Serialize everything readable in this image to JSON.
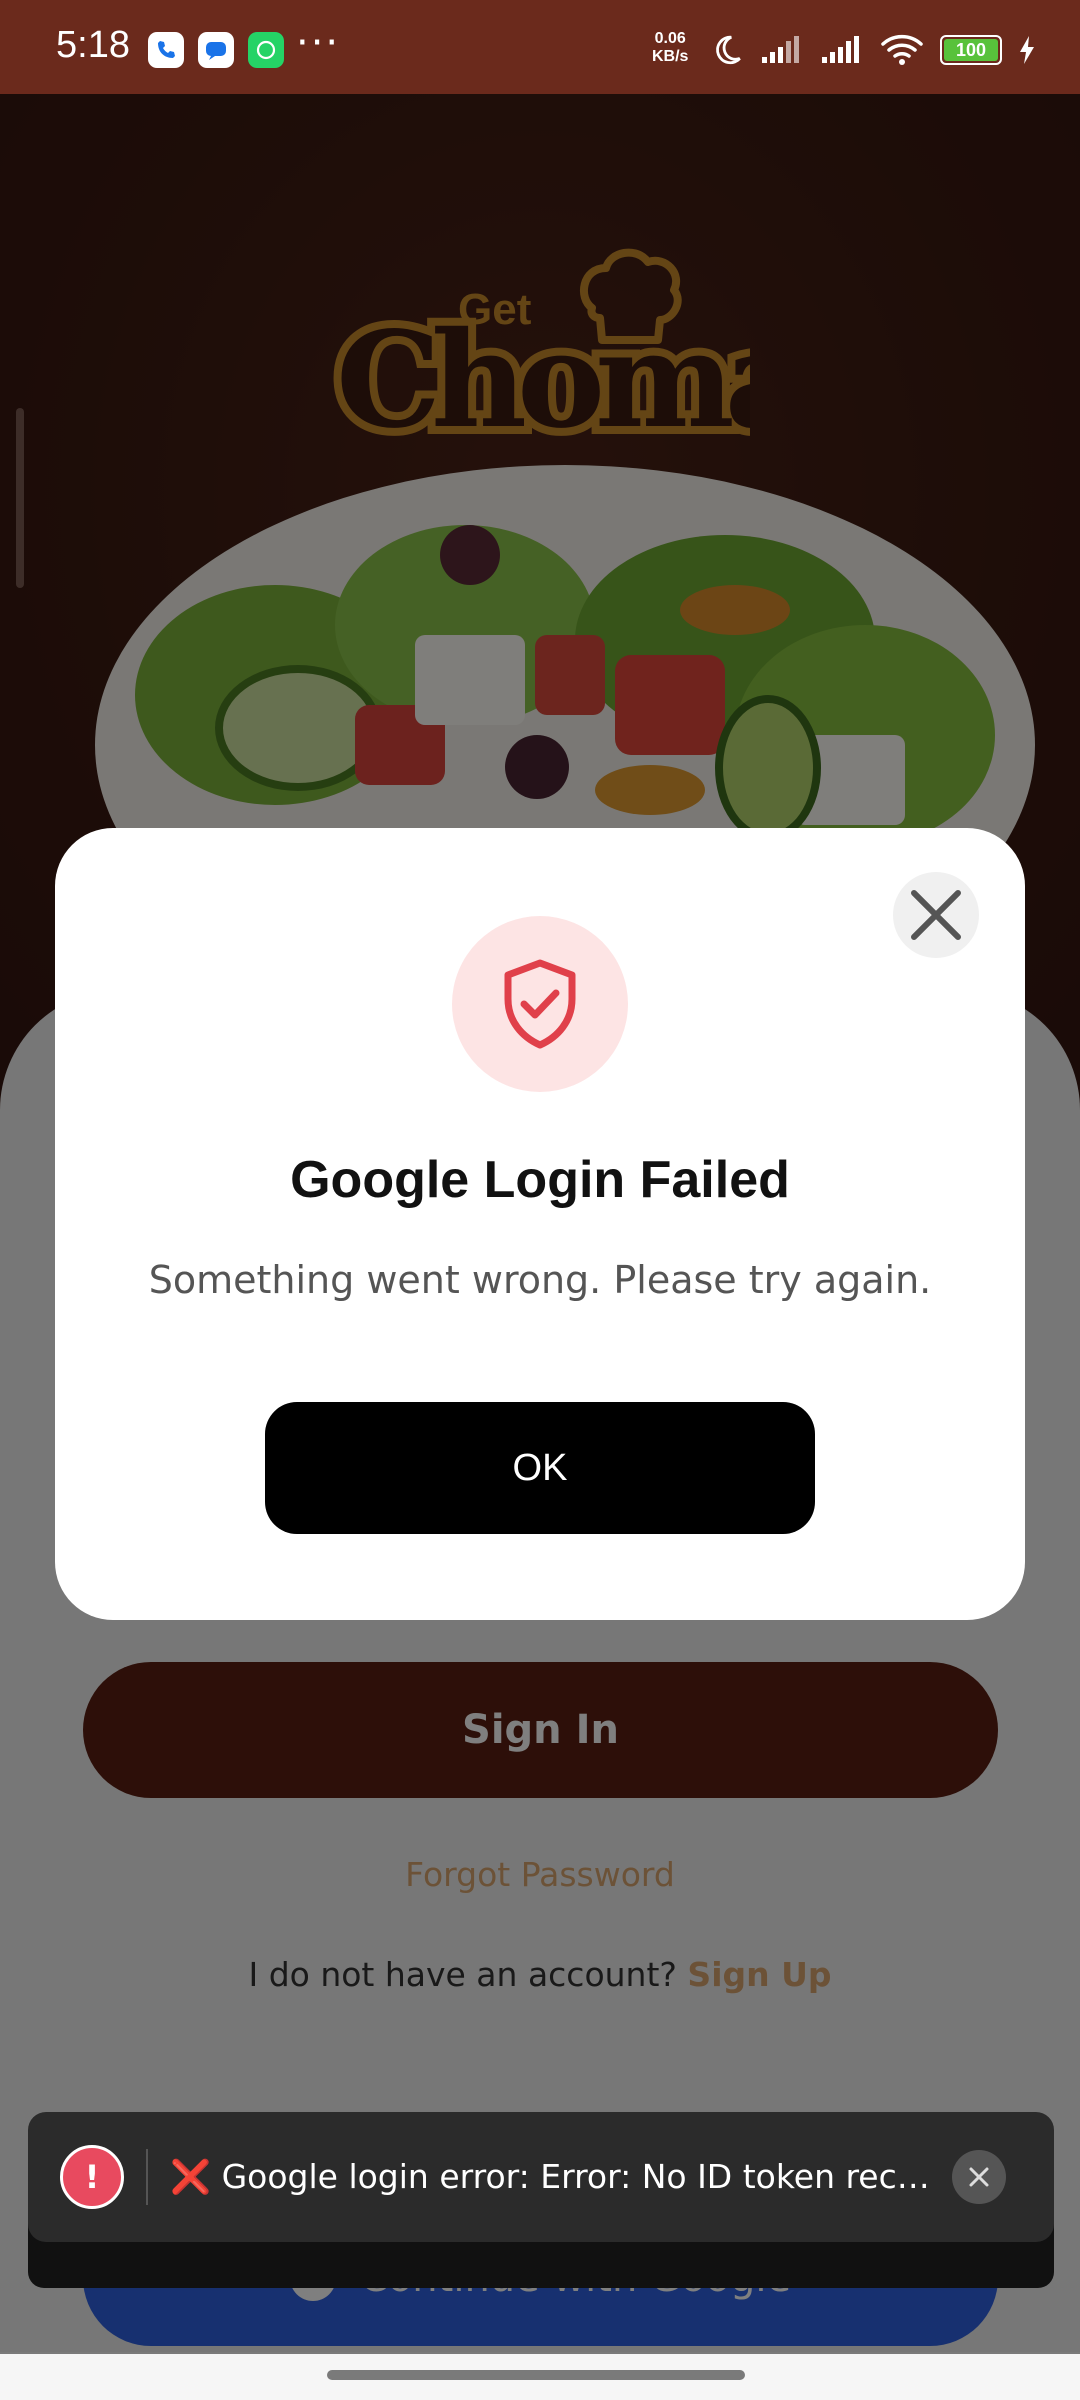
{
  "status_bar": {
    "time": "5:18",
    "net_speed_value": "0.06",
    "net_speed_unit": "KB/s",
    "battery": "100",
    "apps": [
      "phone-icon",
      "messages-icon",
      "whatsapp-icon"
    ],
    "more": "···"
  },
  "brand": {
    "logo_small": "Get",
    "logo_big": "Choma",
    "accent": "#c98a2a"
  },
  "login": {
    "signin_label": "Sign In",
    "forgot_label": "Forgot Password",
    "no_account_text": "I do not have an account?",
    "signup_label": "Sign Up",
    "google_label": "Continue with Google"
  },
  "dialog": {
    "title": "Google Login Failed",
    "message": "Something went wrong. Please try again.",
    "ok_label": "OK",
    "icon": "shield-check-icon"
  },
  "toast": {
    "text": "❌ Google login error: Error: No ID token receiv...",
    "icon": "alert-icon"
  },
  "colors": {
    "status_bar": "#6b2a1c",
    "signin_button": "#5a1f12",
    "link": "#d8a56e",
    "google_button": "#2f61e0",
    "error": "#e84a5f"
  }
}
